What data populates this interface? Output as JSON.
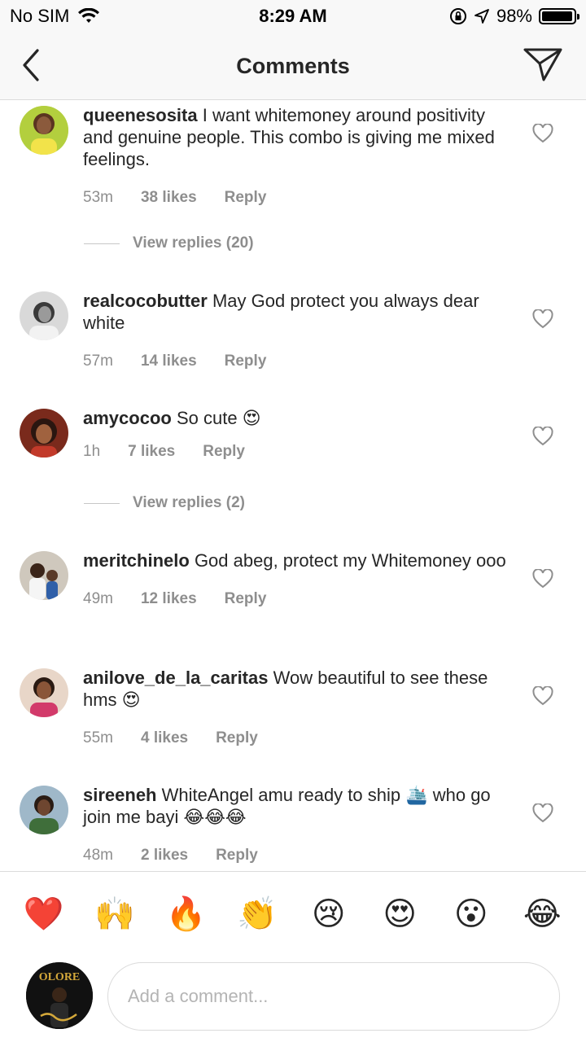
{
  "status": {
    "carrier": "No SIM",
    "time": "8:29 AM",
    "battery": "98%",
    "battery_level": 0.98
  },
  "nav": {
    "title": "Comments"
  },
  "comments": [
    {
      "username": "queenesosita",
      "text": "I want whitemoney around positivity and genuine people. This combo is giving me mixed feelings.",
      "time": "53m",
      "likes": "38 likes",
      "reply": "Reply"
    },
    {
      "username": "realcocobutter",
      "text": "May God protect you always dear white",
      "time": "57m",
      "likes": "14 likes",
      "reply": "Reply"
    },
    {
      "username": "amycocoo",
      "text": "So cute 😍",
      "time": "1h",
      "likes": "7 likes",
      "reply": "Reply"
    },
    {
      "username": "meritchinelo",
      "text": "God abeg, protect my Whitemoney ooo",
      "time": "49m",
      "likes": "12 likes",
      "reply": "Reply"
    },
    {
      "username": "anilove_de_la_caritas",
      "text": "Wow beautiful to see these hms 😍",
      "time": "55m",
      "likes": "4 likes",
      "reply": "Reply"
    },
    {
      "username": "sireeneh",
      "text": "WhiteAngel amu ready to ship 🛳️ who go join me bayi 😂😂😂",
      "time": "48m",
      "likes": "2 likes",
      "reply": "Reply"
    }
  ],
  "view_replies": [
    "View replies (20)",
    "View replies (2)"
  ],
  "reactions": [
    "❤️",
    "🙌",
    "🔥",
    "👏",
    "😢",
    "😍",
    "😮",
    "😂"
  ],
  "composer": {
    "placeholder": "Add a comment...",
    "avatar_text": "OLORE"
  }
}
